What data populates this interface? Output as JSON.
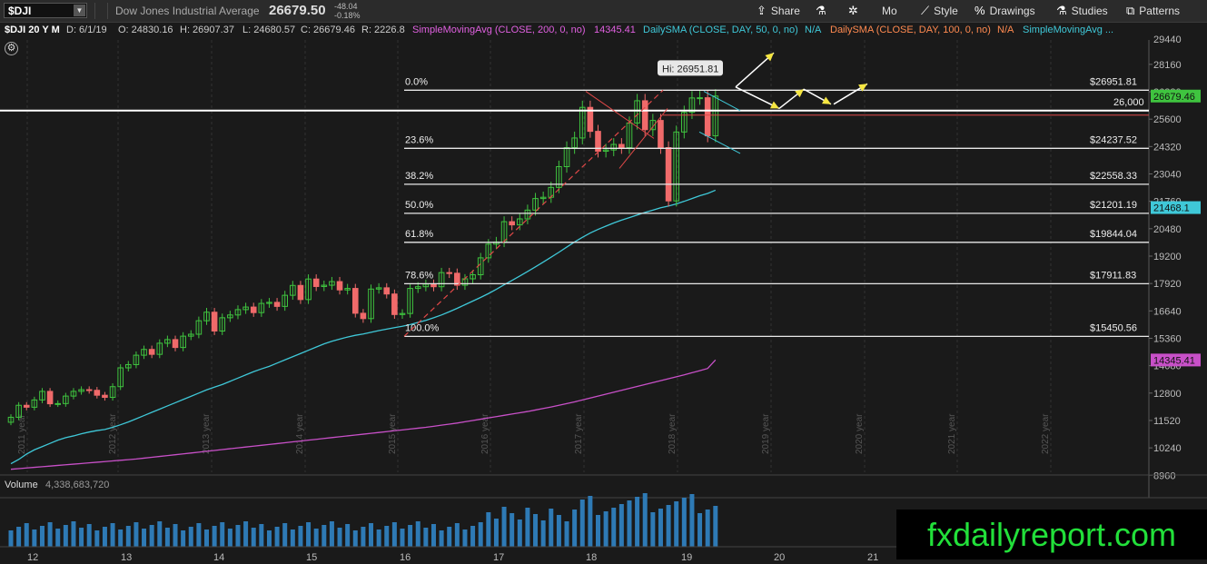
{
  "header": {
    "symbol": "$DJI",
    "name": "Dow Jones Industrial Average",
    "price": "26679.50",
    "change": "-48.04",
    "change_pct": "-0.18%",
    "buttons": [
      {
        "label": "Share",
        "icon": "share-icon"
      },
      {
        "label": "",
        "icon": "flask-icon"
      },
      {
        "label": "",
        "icon": "gear-icon"
      },
      {
        "label": "Mo",
        "icon": ""
      },
      {
        "label": "Style",
        "icon": "style-icon"
      },
      {
        "label": "Drawings",
        "icon": "percent-icon"
      },
      {
        "label": "Studies",
        "icon": "flask-icon"
      },
      {
        "label": "Patterns",
        "icon": "patterns-icon"
      }
    ]
  },
  "infobar": {
    "title": "$DJI 20 Y M",
    "date": "D: 6/1/19",
    "open": "O: 24830.16",
    "high": "H: 26907.37",
    "low": "L: 24680.57",
    "close": "C: 26679.46",
    "range": "R: 2226.8",
    "sma200": "SimpleMovingAvg (CLOSE, 200, 0, no)",
    "sma200_val": "14345.41",
    "dsma50": "DailySMA (CLOSE, DAY, 50, 0, no)",
    "dsma50_val": "N/A",
    "dsma100": "DailySMA (CLOSE, DAY, 100, 0, no)",
    "dsma100_val": "N/A",
    "sma_more": "SimpleMovingAvg ..."
  },
  "colors": {
    "up": "#3fc43f",
    "down": "#f06a6a",
    "sma50": "#3fc8d8",
    "sma200": "#c850c8",
    "fib": "#e8e8e8"
  },
  "chart_data": {
    "type": "candlestick",
    "title": "$DJI 20 Y M",
    "ylim": [
      9100,
      29300
    ],
    "y_ticks": [
      "28160",
      "26880",
      "25600",
      "24320",
      "23040",
      "21760",
      "20480",
      "19200",
      "17920",
      "16640",
      "15360",
      "14080",
      "12800",
      "11520",
      "10240",
      "8960"
    ],
    "year_labels": [
      "2011 year",
      "2012 year",
      "2013 year",
      "2014 year",
      "2015 year",
      "2016 year",
      "2017 year",
      "2018 year",
      "2019 year",
      "2020 year",
      "2021 year",
      "2022 year"
    ],
    "x_ticks": [
      "12",
      "13",
      "14",
      "15",
      "16",
      "17",
      "18",
      "19",
      "20",
      "21"
    ],
    "fib_levels": [
      {
        "pct": "0.0%",
        "price": "$26951.81",
        "value": 26951.81
      },
      {
        "pct": "23.6%",
        "price": "$24237.52",
        "value": 24237.52
      },
      {
        "pct": "38.2%",
        "price": "$22558.33",
        "value": 22558.33
      },
      {
        "pct": "50.0%",
        "price": "$21201.19",
        "value": 21201.19
      },
      {
        "pct": "61.8%",
        "price": "$19844.04",
        "value": 19844.04
      },
      {
        "pct": "78.6%",
        "price": "$17911.83",
        "value": 17911.83
      },
      {
        "pct": "100.0%",
        "price": "$15450.56",
        "value": 15450.56
      }
    ],
    "hline": {
      "label": "26,000",
      "value": 26000
    },
    "hi_label": "Hi: 26951.81",
    "price_tags": [
      {
        "label": "26679.46",
        "value": 26679.46,
        "color": "#3fc43f"
      },
      {
        "label": "21468.1",
        "value": 21468.1,
        "color": "#3fc8d8"
      },
      {
        "label": "14345.41",
        "value": 14345.41,
        "color": "#c850c8"
      }
    ],
    "series_close": [
      11670,
      12230,
      12140,
      12480,
      12880,
      12300,
      12310,
      12660,
      12880,
      12960,
      12930,
      12700,
      12600,
      13100,
      13980,
      14130,
      14570,
      14840,
      14610,
      15130,
      15300,
      14930,
      15460,
      15550,
      16180,
      16580,
      15700,
      16320,
      16450,
      16700,
      16820,
      16560,
      16990,
      17040,
      16850,
      17370,
      17830,
      17170,
      18130,
      17780,
      17840,
      18010,
      17620,
      17690,
      16530,
      16280,
      17660,
      17720,
      17430,
      16470,
      16520,
      17690,
      17770,
      17890,
      17770,
      18430,
      18400,
      17840,
      18140,
      18330,
      19120,
      19760,
      19860,
      20810,
      20660,
      20940,
      21350,
      21890,
      21950,
      22410,
      23380,
      24270,
      24720,
      26150,
      25030,
      24100,
      24160,
      24420,
      24270,
      25420,
      26460,
      25110,
      25540,
      24270,
      21780,
      25000,
      25920,
      26590,
      26600,
      24820,
      26680
    ],
    "series_sma50": [
      9500,
      9700,
      9950,
      10150,
      10300,
      10450,
      10600,
      10720,
      10800,
      10900,
      10980,
      11050,
      11100,
      11200,
      11320,
      11450,
      11600,
      11750,
      11900,
      12050,
      12200,
      12350,
      12500,
      12650,
      12800,
      12950,
      13080,
      13200,
      13350,
      13500,
      13650,
      13800,
      13930,
      14050,
      14200,
      14350,
      14500,
      14650,
      14800,
      14950,
      15100,
      15220,
      15320,
      15420,
      15500,
      15560,
      15640,
      15720,
      15790,
      15860,
      15920,
      16000,
      16100,
      16200,
      16320,
      16450,
      16600,
      16760,
      16930,
      17100,
      17270,
      17450,
      17650,
      17860,
      18060,
      18270,
      18480,
      18700,
      18920,
      19150,
      19380,
      19620,
      19860,
      20080,
      20280,
      20450,
      20600,
      20750,
      20880,
      21000,
      21120,
      21240,
      21350,
      21460,
      21540,
      21640,
      21760,
      21890,
      22020,
      22130,
      22280
    ],
    "series_sma200": [
      9240,
      9270,
      9300,
      9330,
      9360,
      9390,
      9420,
      9450,
      9480,
      9510,
      9540,
      9570,
      9600,
      9630,
      9660,
      9690,
      9720,
      9760,
      9800,
      9840,
      9880,
      9920,
      9960,
      10000,
      10040,
      10080,
      10120,
      10160,
      10200,
      10240,
      10280,
      10320,
      10360,
      10400,
      10440,
      10480,
      10520,
      10560,
      10600,
      10640,
      10680,
      10720,
      10760,
      10800,
      10840,
      10880,
      10920,
      10960,
      11000,
      11040,
      11080,
      11120,
      11160,
      11200,
      11250,
      11300,
      11350,
      11400,
      11460,
      11520,
      11580,
      11640,
      11700,
      11760,
      11820,
      11880,
      11940,
      12010,
      12080,
      12150,
      12230,
      12310,
      12390,
      12480,
      12570,
      12660,
      12750,
      12840,
      12930,
      13020,
      13110,
      13200,
      13290,
      13380,
      13470,
      13560,
      13650,
      13750,
      13850,
      13950,
      14350
    ],
    "volume": {
      "label": "Volume",
      "value": "4,338,683,720"
    }
  },
  "watermark": "fxdailyreport.com"
}
